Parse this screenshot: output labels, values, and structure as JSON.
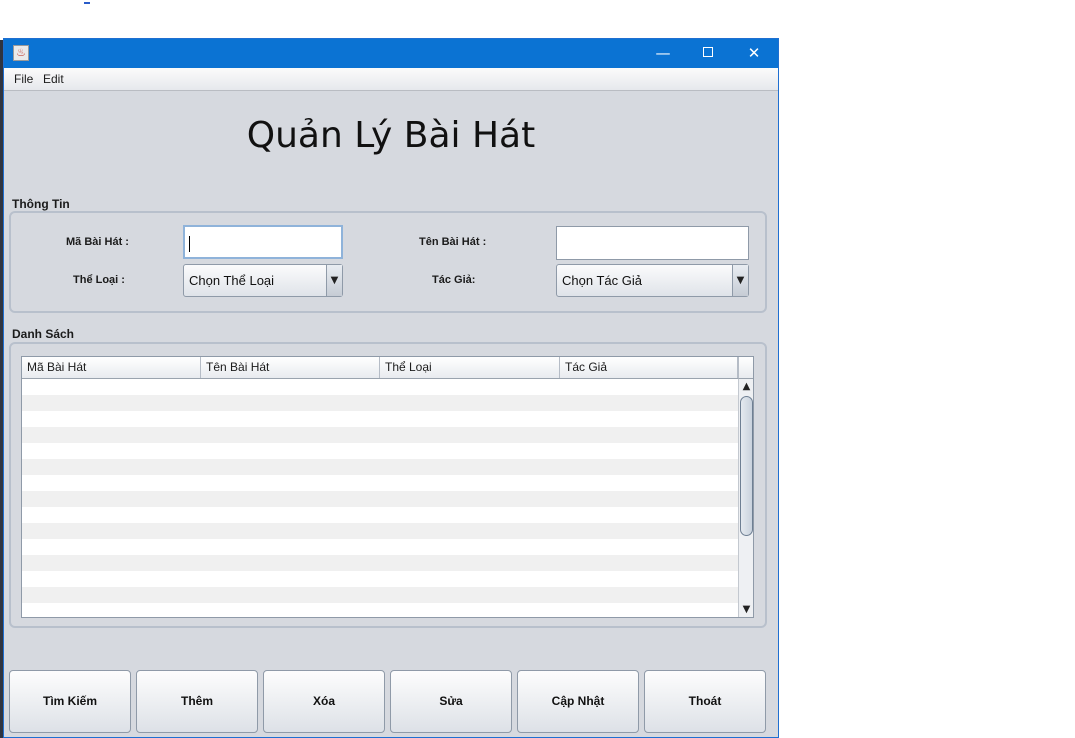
{
  "window": {
    "controls": {
      "minimize": "—",
      "close": "✕"
    }
  },
  "menubar": {
    "items": [
      "File",
      "Edit"
    ]
  },
  "page_title": "Quản Lý Bài Hát",
  "info_section": {
    "title": "Thông Tin",
    "ma_bai_hat_label": "Mã Bài Hát :",
    "ma_bai_hat_value": "",
    "ten_bai_hat_label": "Tên Bài Hát :",
    "ten_bai_hat_value": "",
    "the_loai_label": "Thể Loại :",
    "the_loai_selected": "Chọn Thể Loại",
    "tac_gia_label": "Tác Giả:",
    "tac_gia_selected": "Chọn Tác Giả"
  },
  "list_section": {
    "title": "Danh Sách",
    "columns": [
      "Mã Bài Hát",
      "Tên Bài Hát",
      "Thể Loại",
      "Tác Giả"
    ],
    "rows": []
  },
  "buttons": {
    "search": "Tìm Kiếm",
    "add": "Thêm",
    "delete": "Xóa",
    "edit": "Sửa",
    "update": "Cập Nhật",
    "exit": "Thoát"
  },
  "icons": {
    "app": "java-coffee-icon",
    "combo_arrow": "chevron-down-icon",
    "scroll_up": "arrow-up-icon",
    "scroll_down": "arrow-down-icon"
  },
  "colors": {
    "titlebar": "#0b73d3",
    "window_bg": "#d6d9df",
    "row_alt": "#f0f0f0"
  }
}
